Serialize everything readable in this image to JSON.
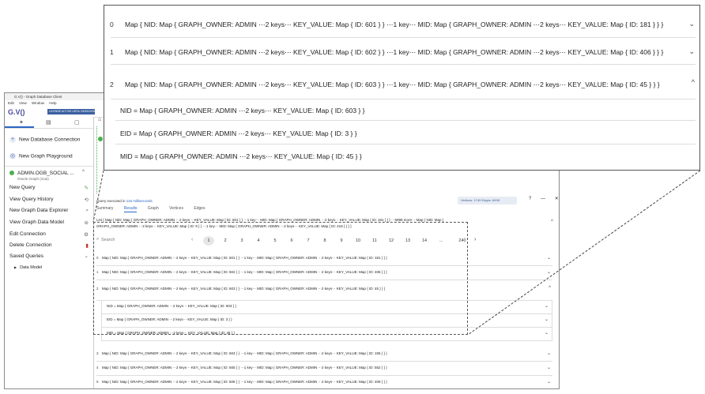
{
  "window": {
    "title": "G.V() - Graph Database Client",
    "menu": [
      "Edit",
      "View",
      "Window",
      "Help"
    ]
  },
  "toolbar": {
    "logo": "G.V()",
    "badge": "LICENSE ACTIVE UNTIL 03/09/2025"
  },
  "sidebar": {
    "tabs": [
      "share-icon",
      "database-icon",
      "bookmark-icon"
    ],
    "new_connection": "New Database Connection",
    "new_playground": "New Graph Playground",
    "connection_name": "ADMIN.OGB_SOCIAL ...",
    "connection_sub": "Oracle Graph (21ai)",
    "items": [
      {
        "label": "New Query",
        "icon": "pencil-icon"
      },
      {
        "label": "View Query History",
        "icon": "history-icon"
      },
      {
        "label": "New Graph Data Explorer",
        "icon": "explore-icon"
      },
      {
        "label": "View Graph Data Model",
        "icon": "model-icon"
      },
      {
        "label": "Edit Connection",
        "icon": "edit-icon"
      },
      {
        "label": "Delete Connection",
        "icon": "trash-icon"
      },
      {
        "label": "Saved Queries",
        "icon": "chevron-icon"
      }
    ],
    "data_model": "Data Model"
  },
  "query": {
    "executed_prefix": "Query executed in",
    "executed_time": "115 milliseconds",
    "stats": "Vertices: 1749   Edges: 6008",
    "tabs": [
      "Summary",
      "Results",
      "Graph",
      "Vertices",
      "Edges"
    ],
    "active_tab": "Results",
    "summary_line_1": "List { Map { NID: Map { GRAPH_OWNER: ADMIN ⋯2 keys⋯ KEY_VALUE: Map { ID: 601 } } ⋯1 key⋯ MID: Map { GRAPH_OWNER: ADMIN ⋯2 keys⋯ KEY_VALUE: Map { ID: 181 } } } ⋯5998 more⋯ Map { NID: Map {",
    "summary_line_2": "GRAPH_OWNER: ADMIN ⋯2 keys⋯ KEY_VALUE: Map { ID: 9 } } ⋯1 key⋯ MID: Map { GRAPH_OWNER: ADMIN ⋯2 keys⋯ KEY_VALUE: Map { ID: 219 } } } }",
    "search_placeholder": "Search",
    "pages": [
      "1",
      "2",
      "3",
      "4",
      "5",
      "6",
      "7",
      "8",
      "9",
      "10",
      "11",
      "12",
      "13",
      "14",
      "...",
      "240"
    ],
    "current_page": "1"
  },
  "rows": [
    {
      "idx": "0",
      "nid": "601",
      "mid": "181"
    },
    {
      "idx": "1",
      "nid": "602",
      "mid": "406"
    },
    {
      "idx": "2",
      "nid": "603",
      "mid": "45"
    },
    {
      "idx": "3",
      "nid": "604",
      "mid": "155"
    },
    {
      "idx": "4",
      "nid": "605",
      "mid": "552"
    },
    {
      "idx": "5",
      "nid": "606",
      "mid": "409"
    },
    {
      "idx": "6",
      "nid": "607",
      "mid": "205"
    }
  ],
  "expanded": {
    "nid": "NID = Map { GRAPH_OWNER: ADMIN ⋯2 keys⋯ KEY_VALUE: Map { ID: 603 } }",
    "eid": "EID = Map { GRAPH_OWNER: ADMIN ⋯2 keys⋯ KEY_VALUE: Map { ID: 3 } }",
    "mid": "MID = Map { GRAPH_OWNER: ADMIN ⋯2 keys⋯ KEY_VALUE: Map { ID: 45 } }"
  },
  "zoom_rows": [
    "Map { NID: Map { GRAPH_OWNER: ADMIN ⋯2 keys⋯ KEY_VALUE: Map { ID: 601 } } ⋯1 key⋯ MID: Map { GRAPH_OWNER: ADMIN ⋯2 keys⋯ KEY_VALUE: Map { ID: 181 } } }",
    "Map { NID: Map { GRAPH_OWNER: ADMIN ⋯2 keys⋯ KEY_VALUE: Map { ID: 602 } } ⋯1 key⋯ MID: Map { GRAPH_OWNER: ADMIN ⋯2 keys⋯ KEY_VALUE: Map { ID: 406 } } }",
    "Map { NID: Map { GRAPH_OWNER: ADMIN ⋯2 keys⋯ KEY_VALUE: Map { ID: 603 } } ⋯1 key⋯ MID: Map { GRAPH_OWNER: ADMIN ⋯2 keys⋯ KEY_VALUE: Map { ID: 45 } } }"
  ],
  "colors": {
    "accent": "#2b66c4",
    "logo": "#4b4b9a",
    "badge": "#3a5fa0"
  }
}
